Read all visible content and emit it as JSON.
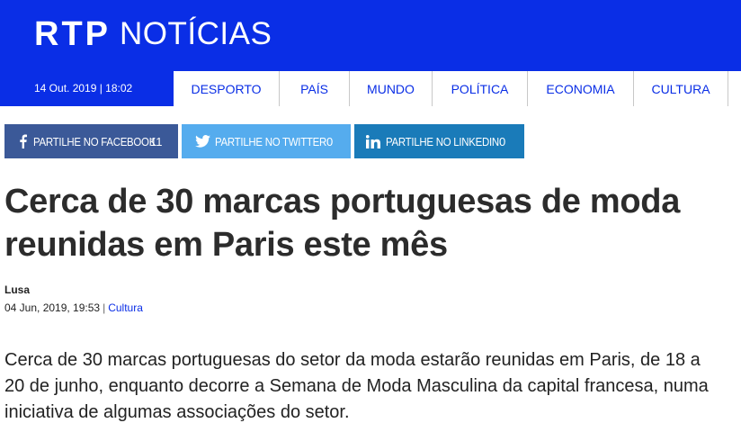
{
  "header": {
    "logo_brand": "RTP",
    "logo_section": "NOTÍCIAS",
    "date": "14 Out. 2019 | 18:02",
    "brand_color": "#0a2ee6"
  },
  "nav": {
    "items": [
      {
        "label": "DESPORTO"
      },
      {
        "label": "PAÍS"
      },
      {
        "label": "MUNDO"
      },
      {
        "label": "POLÍTICA"
      },
      {
        "label": "ECONOMIA"
      },
      {
        "label": "CULTURA"
      }
    ]
  },
  "share": {
    "facebook": {
      "label": "PARTILHE NO FACEBOOK",
      "count": "11",
      "icon": "facebook-icon",
      "color": "#3b5998"
    },
    "twitter": {
      "label": "PARTILHE NO TWITTER",
      "count": "0",
      "icon": "twitter-icon",
      "color": "#55acee"
    },
    "linkedin": {
      "label": "PARTILHE NO LINKEDIN",
      "count": "0",
      "icon": "linkedin-icon",
      "color": "#1a7bb9"
    }
  },
  "article": {
    "title": "Cerca de 30 marcas portuguesas de moda reunidas em Paris este mês",
    "author": "Lusa",
    "date": "04 Jun, 2019, 19:53",
    "separator": "|",
    "category": "Cultura",
    "lead": "Cerca de 30 marcas portuguesas do setor da moda estarão reunidas em Paris, de 18 a 20 de junho, enquanto decorre a Semana de Moda Masculina da capital francesa, numa iniciativa de algumas associações do setor."
  }
}
